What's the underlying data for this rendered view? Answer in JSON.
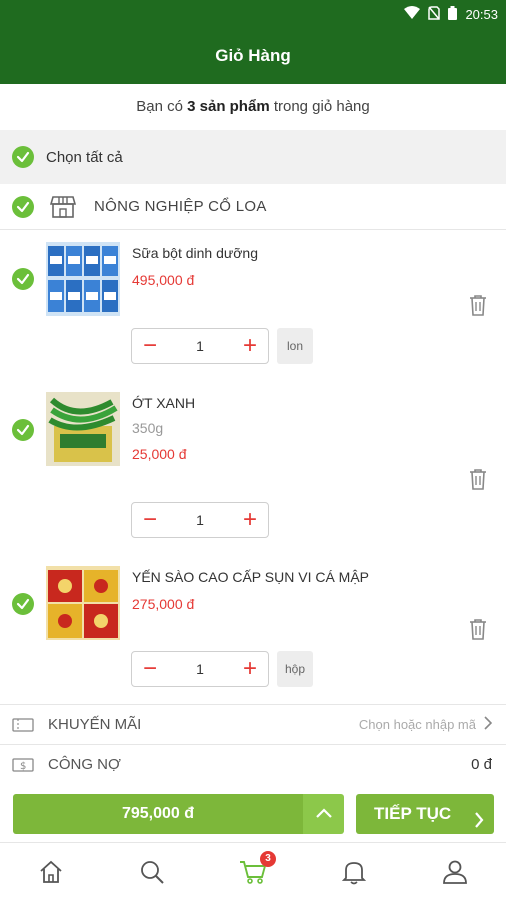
{
  "status_bar": {
    "time": "20:53"
  },
  "header": {
    "title": "Giỏ Hàng"
  },
  "summary": {
    "prefix": "Bạn có",
    "count_text": "3 sản phẩm",
    "suffix": "trong giỏ hàng"
  },
  "select_all": {
    "label": "Chọn tất cả"
  },
  "shop": {
    "name": "NÔNG NGHIỆP CỔ LOA"
  },
  "items": [
    {
      "title": "Sữa bột dinh dưỡng",
      "weight": "",
      "price": "495,000 đ",
      "quantity": "1",
      "unit": "lon"
    },
    {
      "title": "ỚT XANH",
      "weight": "350g",
      "price": "25,000 đ",
      "quantity": "1",
      "unit": ""
    },
    {
      "title": "YẾN SÀO CAO CẤP SỤN VI CÁ MẬP",
      "weight": "",
      "price": "275,000 đ",
      "quantity": "1",
      "unit": "hộp"
    }
  ],
  "promo": {
    "label": "KHUYẾN MÃI",
    "hint": "Chọn hoặc nhập mã"
  },
  "debt": {
    "label": "CÔNG NỢ",
    "value": "0 đ"
  },
  "footer": {
    "total": "795,000 đ",
    "continue_label": "TIẾP TỤC"
  },
  "nav": {
    "cart_badge": "3",
    "tabs": [
      "home-icon",
      "search-icon",
      "cart-icon",
      "bell-icon",
      "user-icon"
    ]
  },
  "colors": {
    "primary": "#1f6b1f",
    "accent": "#7db73a",
    "price": "#e53935",
    "check": "#6bbf3a"
  }
}
